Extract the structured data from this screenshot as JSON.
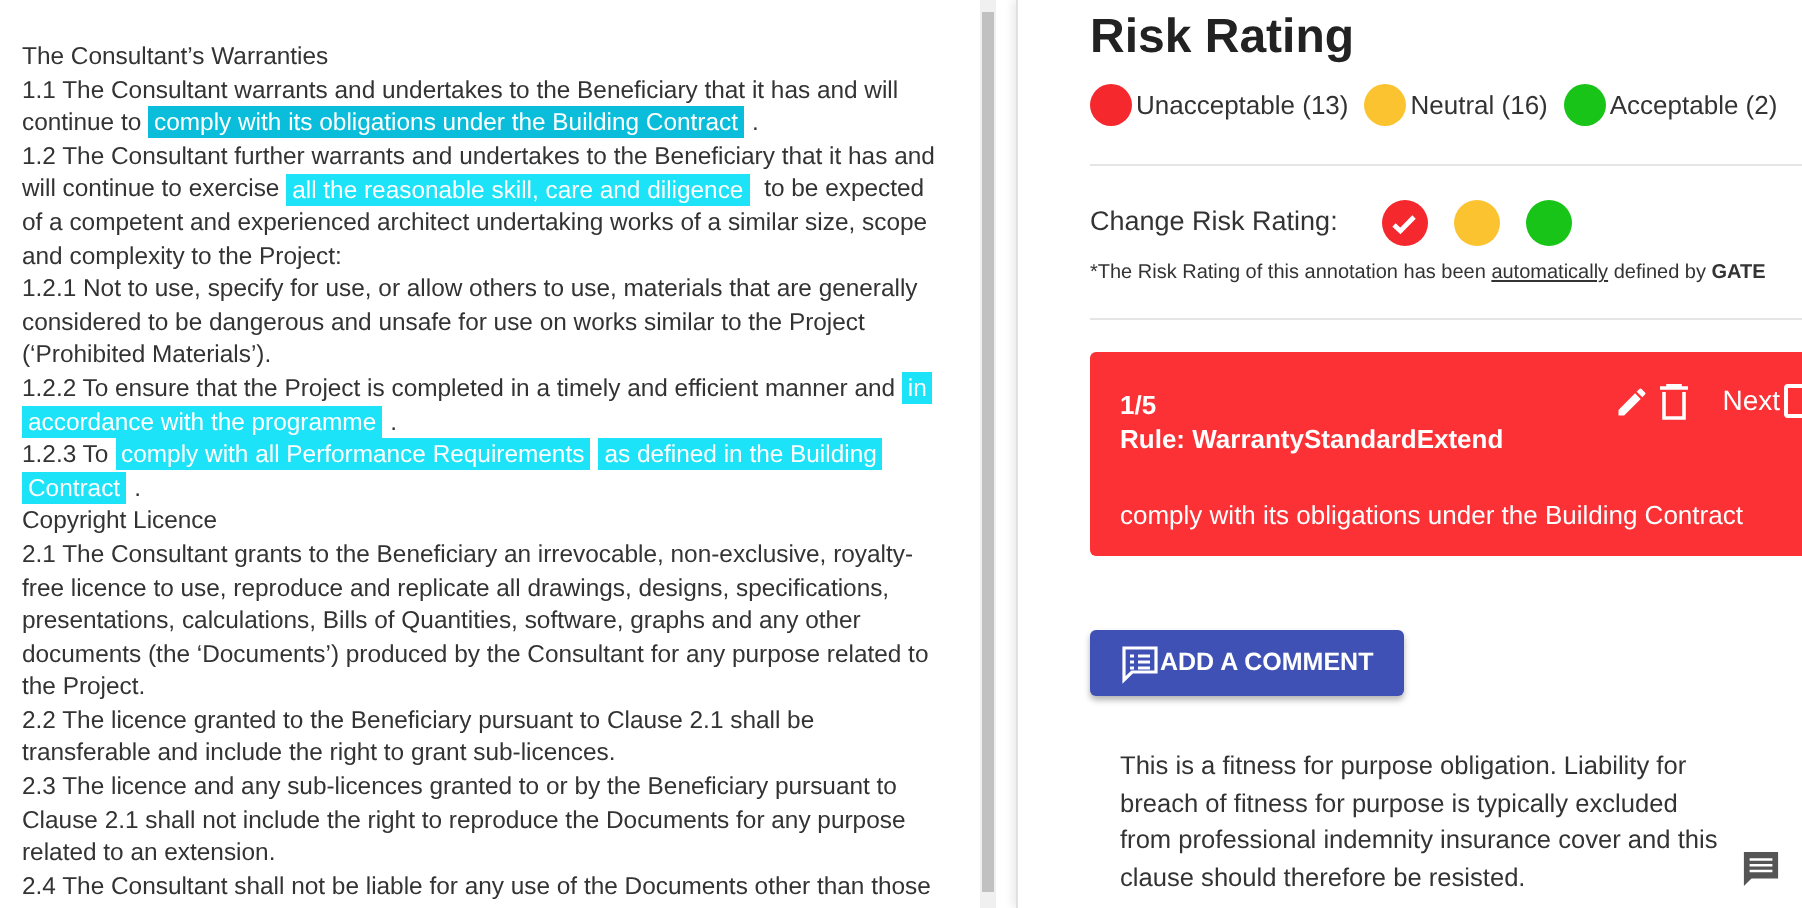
{
  "document": {
    "lines": [
      [
        {
          "kind": "text",
          "text": "The Consultant’s Warranties"
        }
      ],
      [
        {
          "kind": "text",
          "text": "1.1 The Consultant warrants and undertakes to the Beneficiary that it has and will"
        }
      ],
      [
        {
          "kind": "text",
          "text": "continue to "
        },
        {
          "kind": "highlight",
          "text": "comply with its obligations under the Building Contract",
          "selected": true
        },
        {
          "kind": "text",
          "text": "."
        }
      ],
      [
        {
          "kind": "text",
          "text": "1.2 The Consultant further warrants and undertakes to the Beneficiary that it has and"
        }
      ],
      [
        {
          "kind": "text",
          "text": "will continue to exercise "
        },
        {
          "kind": "highlight",
          "text": "all the reasonable skill, care and diligence",
          "selected": false
        },
        {
          "kind": "text",
          "text": " to be expected"
        }
      ],
      [
        {
          "kind": "text",
          "text": "of a competent and experienced architect undertaking works of a similar size, scope"
        }
      ],
      [
        {
          "kind": "text",
          "text": "and complexity to the Project:"
        }
      ],
      [
        {
          "kind": "text",
          "text": "1.2.1 Not to use, specify for use, or allow others to use, materials that are generally"
        }
      ],
      [
        {
          "kind": "text",
          "text": "considered to be dangerous and unsafe for use on works similar to the Project"
        }
      ],
      [
        {
          "kind": "text",
          "text": "(‘Prohibited Materials’)."
        }
      ],
      [
        {
          "kind": "text",
          "text": "1.2.2 To ensure that the Project is completed in a timely and efficient manner and "
        },
        {
          "kind": "highlight",
          "text": "in",
          "selected": false
        }
      ],
      [
        {
          "kind": "highlight",
          "text": "accordance with the programme",
          "selected": false
        },
        {
          "kind": "text",
          "text": "."
        }
      ],
      [
        {
          "kind": "text",
          "text": "1.2.3 To "
        },
        {
          "kind": "highlight",
          "text": "comply with all Performance Requirements",
          "selected": false
        },
        {
          "kind": "highlight",
          "text": "as defined in the Building",
          "selected": false
        }
      ],
      [
        {
          "kind": "highlight",
          "text": "Contract",
          "selected": false
        },
        {
          "kind": "text",
          "text": "."
        }
      ],
      [
        {
          "kind": "text",
          "text": "Copyright Licence"
        }
      ],
      [
        {
          "kind": "text",
          "text": "2.1 The Consultant grants to the Beneficiary an irrevocable, non-exclusive, royalty-"
        }
      ],
      [
        {
          "kind": "text",
          "text": "free licence to use, reproduce and replicate all drawings, designs, specifications,"
        }
      ],
      [
        {
          "kind": "text",
          "text": "presentations, calculations, Bills of Quantities, software, graphs and any other"
        }
      ],
      [
        {
          "kind": "text",
          "text": "documents (the ‘Documents’) produced by the Consultant for any purpose related to"
        }
      ],
      [
        {
          "kind": "text",
          "text": "the Project."
        }
      ],
      [
        {
          "kind": "text",
          "text": "2.2 The licence granted to the Beneficiary pursuant to Clause 2.1 shall be"
        }
      ],
      [
        {
          "kind": "text",
          "text": "transferable and include the right to grant sub-licences."
        }
      ],
      [
        {
          "kind": "text",
          "text": "2.3 The licence and any sub-licences granted to or by the Beneficiary pursuant to"
        }
      ],
      [
        {
          "kind": "text",
          "text": "Clause 2.1 shall not include the right to reproduce the Documents for any purpose"
        }
      ],
      [
        {
          "kind": "text",
          "text": "related to an extension."
        }
      ],
      [
        {
          "kind": "text",
          "text": "2.4 The Consultant shall not be liable for any use of the Documents other than those"
        }
      ]
    ]
  },
  "panel": {
    "title": "Risk Rating",
    "legend": [
      {
        "label": "Unacceptable (13)",
        "color": "#f5282e"
      },
      {
        "label": "Neutral (16)",
        "color": "#fbc330"
      },
      {
        "label": "Acceptable (2)",
        "color": "#18c418"
      }
    ],
    "change_label": "Change Risk Rating:",
    "change_options": [
      {
        "color": "#f5282e",
        "selected": true
      },
      {
        "color": "#fbc330",
        "selected": false
      },
      {
        "color": "#18c418",
        "selected": false
      }
    ],
    "note": {
      "before": "*The Risk Rating of this annotation has been ",
      "link": "automatically",
      "middle": " defined by ",
      "bold": "GATE"
    },
    "annotation": {
      "position": "1/5",
      "rule": "Rule: WarrantyStandardExtend",
      "next": "Next",
      "next_checked": false,
      "text": "comply with its obligations under the Building Contract"
    },
    "comment_button": "ADD A COMMENT",
    "comment": "This is a fitness for purpose obligation. Liability for breach of fitness for purpose is typically excluded from professional indemnity insurance cover and this clause should therefore be resisted."
  }
}
